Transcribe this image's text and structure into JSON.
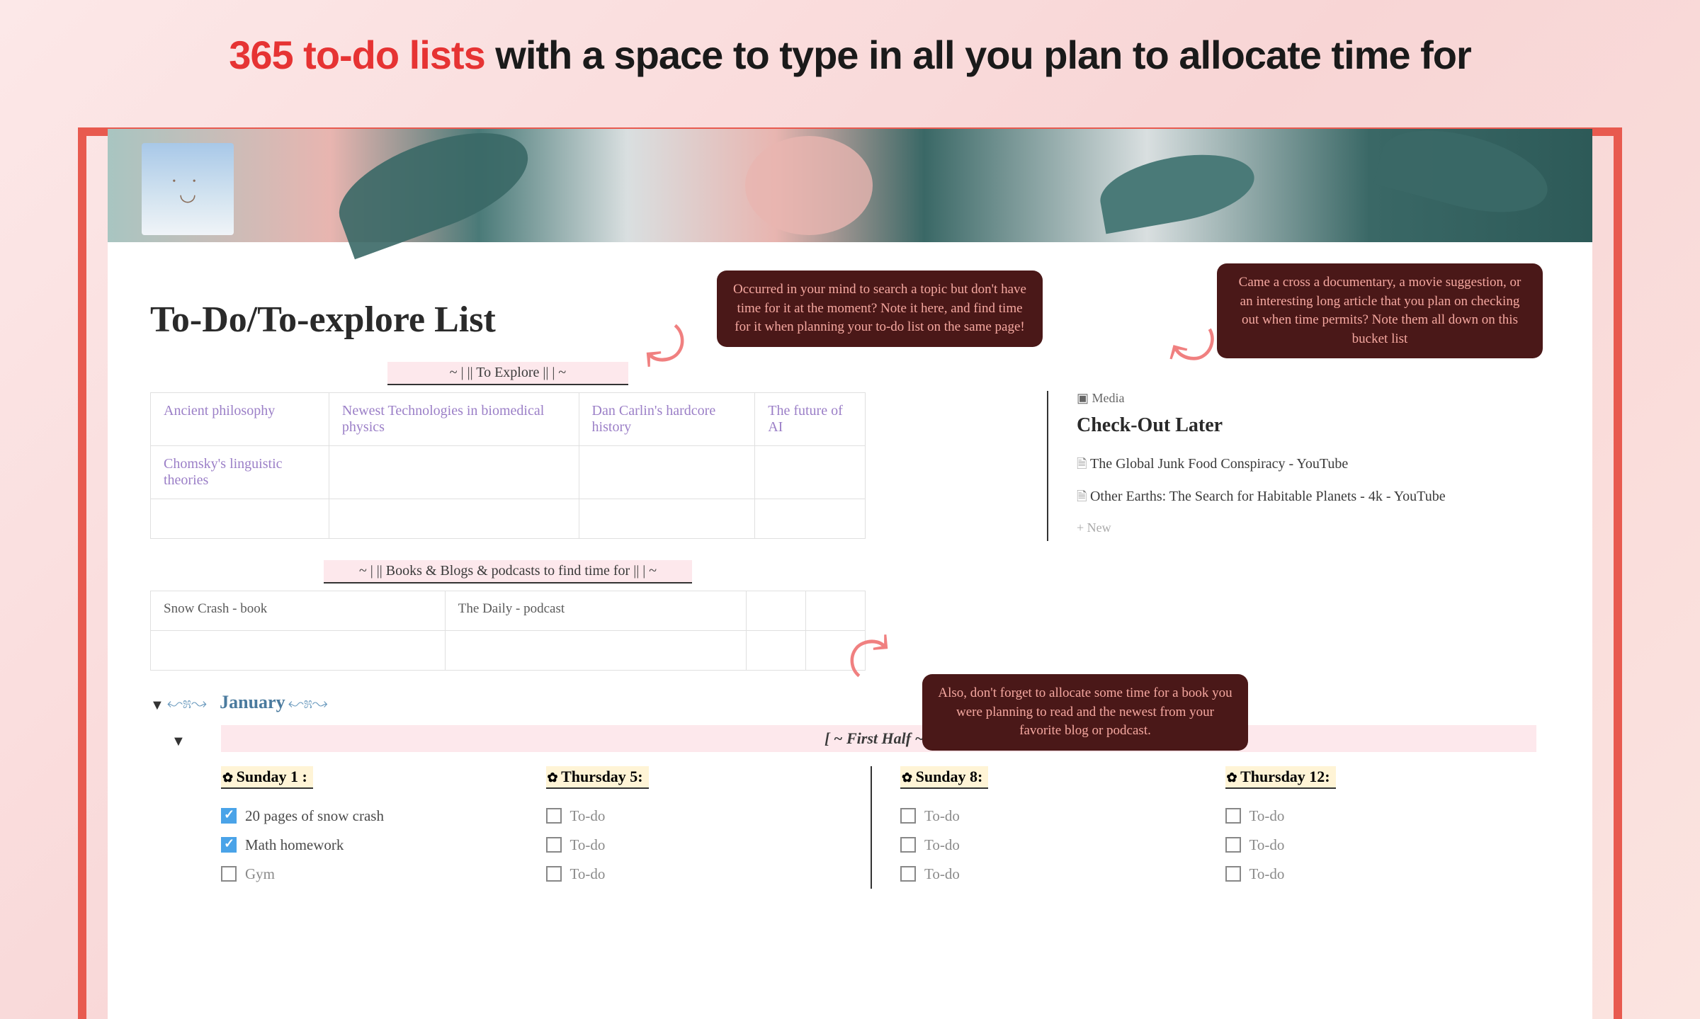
{
  "headline": {
    "red": "365 to-do lists",
    "black": " with a space to type in all you plan to allocate time for"
  },
  "page_title": "To-Do/To-explore List",
  "sections": {
    "explore_label": "~ | || To Explore || | ~",
    "books_label": "~ | || Books & Blogs & podcasts to find time for || | ~"
  },
  "explore_grid": [
    [
      "Ancient philosophy",
      "Newest Technologies in biomedical physics",
      "Dan Carlin's hardcore history",
      "The future of AI"
    ],
    [
      "Chomsky's linguistic theories",
      "",
      "",
      ""
    ],
    [
      "",
      "",
      "",
      ""
    ]
  ],
  "books_grid": [
    [
      "Snow Crash - book",
      "The Daily - podcast",
      "",
      ""
    ],
    [
      "",
      "",
      "",
      ""
    ]
  ],
  "right": {
    "media_label": "Media",
    "checkout_title": "Check-Out Later",
    "items": [
      "The Global Junk Food Conspiracy - YouTube",
      "Other Earths: The Search for Habitable Planets - 4k - YouTube"
    ],
    "new_label": "New"
  },
  "annotations": {
    "a1": "Occurred in your mind to search a topic but don't have time for it at the moment? Note it here, and find time for it when planning your to-do list on the same page!",
    "a2": "Came a cross a documentary, a movie suggestion, or an interesting long article that you plan on checking out when time permits? Note them all down on this bucket list",
    "a3": "Also, don't forget to allocate some time for a book you were planning to read and the newest from your favorite blog or podcast."
  },
  "month": {
    "name": "January",
    "half_label": "[ ~ First Half ~ ]"
  },
  "days": [
    {
      "header": "Sunday 1 :",
      "items": [
        {
          "text": "20 pages of snow crash",
          "checked": true
        },
        {
          "text": "Math homework",
          "checked": true
        },
        {
          "text": "Gym",
          "checked": false
        }
      ]
    },
    {
      "header": "Thursday 5:",
      "items": [
        {
          "text": "To-do",
          "checked": false
        },
        {
          "text": "To-do",
          "checked": false
        },
        {
          "text": "To-do",
          "checked": false
        }
      ]
    },
    {
      "header": "Sunday 8:",
      "items": [
        {
          "text": "To-do",
          "checked": false
        },
        {
          "text": "To-do",
          "checked": false
        },
        {
          "text": "To-do",
          "checked": false
        }
      ]
    },
    {
      "header": "Thursday 12:",
      "items": [
        {
          "text": "To-do",
          "checked": false
        },
        {
          "text": "To-do",
          "checked": false
        },
        {
          "text": "To-do",
          "checked": false
        }
      ]
    }
  ]
}
